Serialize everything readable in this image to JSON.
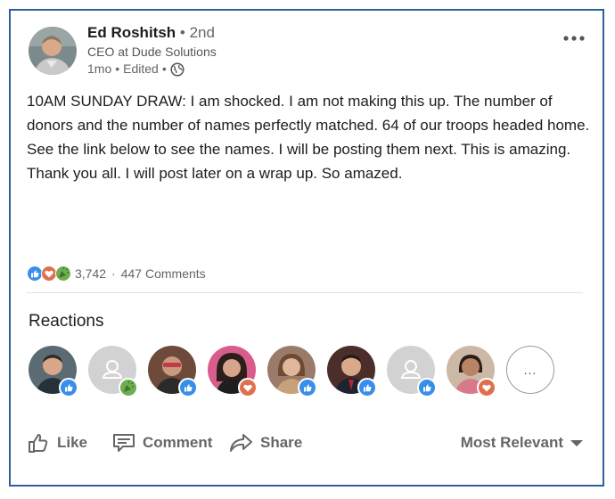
{
  "post": {
    "author": {
      "name": "Ed Roshitsh",
      "degree": "• 2nd",
      "headline": "CEO at Dude Solutions",
      "time": "1mo",
      "edited": "Edited"
    },
    "body": "10AM SUNDAY DRAW:  I am shocked.  I am not making this up.  The number of donors and the number of names perfectly matched.  64 of our troops headed home.  See the link below to see the names.  I will be posting them next.  This is amazing.  Thank you all.  I will post later on a wrap up.  So amazed."
  },
  "social": {
    "reaction_count": "3,742",
    "separator": "·",
    "comments": "447 Comments"
  },
  "reactions": {
    "title": "Reactions",
    "more_label": "...",
    "reactors": [
      {
        "avatar": "person-photo",
        "reaction": "like"
      },
      {
        "avatar": "placeholder",
        "reaction": "celebrate"
      },
      {
        "avatar": "person-photo",
        "reaction": "like"
      },
      {
        "avatar": "person-photo",
        "reaction": "love"
      },
      {
        "avatar": "person-photo",
        "reaction": "like"
      },
      {
        "avatar": "person-photo",
        "reaction": "like"
      },
      {
        "avatar": "placeholder",
        "reaction": "like"
      },
      {
        "avatar": "person-photo",
        "reaction": "love"
      }
    ]
  },
  "actions": {
    "like": "Like",
    "comment": "Comment",
    "share": "Share",
    "sort": "Most Relevant"
  },
  "colors": {
    "frame_border": "#2e5f9e",
    "like_blue": "#378fe9",
    "love_red": "#df704d",
    "celebrate_green": "#44712e",
    "muted_text": "#666666"
  }
}
